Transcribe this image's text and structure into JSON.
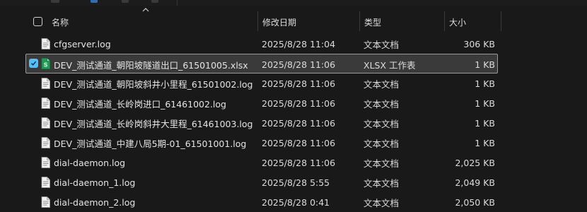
{
  "header": {
    "name_label": "名称",
    "date_label": "修改日期",
    "type_label": "类型",
    "size_label": "大小"
  },
  "files": [
    {
      "name": "cfgserver.log",
      "date": "2025/8/28 11:04",
      "type": "文本文档",
      "size": "306 KB",
      "icon": "text-file-icon",
      "selected": false
    },
    {
      "name": "DEV_测试通道_朝阳坡隧道出口_61501005.xlsx",
      "date": "2025/8/28 11:06",
      "type": "XLSX 工作表",
      "size": "1 KB",
      "icon": "excel-file-icon",
      "selected": true
    },
    {
      "name": "DEV_测试通道_朝阳坡斜井小里程_61501002.log",
      "date": "2025/8/28 11:06",
      "type": "文本文档",
      "size": "1 KB",
      "icon": "text-file-icon",
      "selected": false
    },
    {
      "name": "DEV_测试通道_长岭岗进口_61461002.log",
      "date": "2025/8/28 11:06",
      "type": "文本文档",
      "size": "1 KB",
      "icon": "text-file-icon",
      "selected": false
    },
    {
      "name": "DEV_测试通道_长岭岗斜井大里程_61461003.log",
      "date": "2025/8/28 11:06",
      "type": "文本文档",
      "size": "1 KB",
      "icon": "text-file-icon",
      "selected": false
    },
    {
      "name": "DEV_测试通道_中建八局5期-01_61501001.log",
      "date": "2025/8/28 11:06",
      "type": "文本文档",
      "size": "1 KB",
      "icon": "text-file-icon",
      "selected": false
    },
    {
      "name": "dial-daemon.log",
      "date": "2025/8/28 11:06",
      "type": "文本文档",
      "size": "2,025 KB",
      "icon": "text-file-icon",
      "selected": false
    },
    {
      "name": "dial-daemon_1.log",
      "date": "2025/8/28 5:55",
      "type": "文本文档",
      "size": "2,049 KB",
      "icon": "text-file-icon",
      "selected": false
    },
    {
      "name": "dial-daemon_2.log",
      "date": "2025/8/28 0:41",
      "type": "文本文档",
      "size": "2,050 KB",
      "icon": "text-file-icon",
      "selected": false
    }
  ],
  "colors": {
    "background": "#191919",
    "selected_row": "#3a3a3a",
    "checkbox_accent": "#4cc2ff",
    "excel_green": "#1f9d55"
  }
}
